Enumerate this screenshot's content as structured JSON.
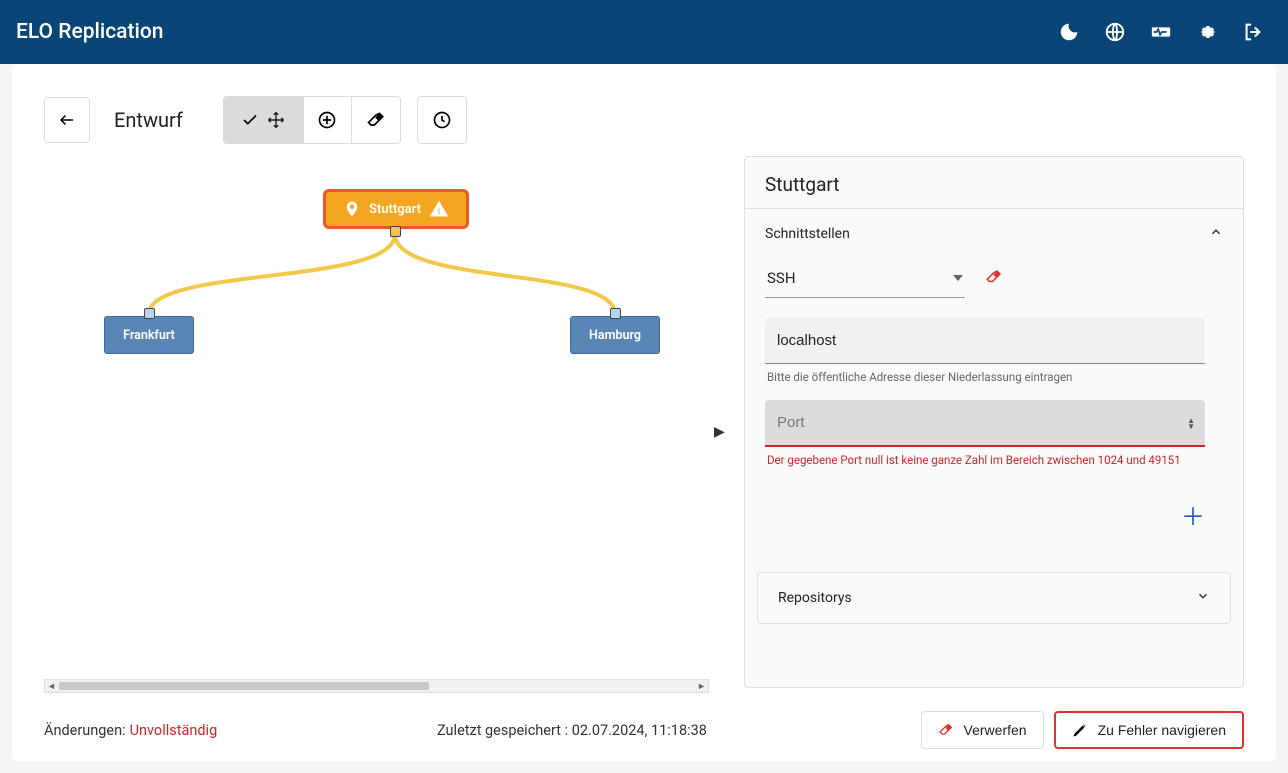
{
  "header": {
    "title": "ELO Replication"
  },
  "page": {
    "draft_label": "Entwurf"
  },
  "canvas": {
    "root_node": "Stuttgart",
    "child_left": "Frankfurt",
    "child_right": "Hamburg"
  },
  "panel": {
    "title": "Stuttgart",
    "section_interfaces": "Schnittstellen",
    "section_repos": "Repositorys",
    "protocol": "SSH",
    "host_value": "localhost",
    "host_hint": "Bitte die öffentliche Adresse dieser Niederlassung eintragen",
    "port_placeholder": "Port",
    "port_error": "Der gegebene Port null ist keine ganze Zahl im Bereich zwischen 1024 und 49151"
  },
  "footer": {
    "changes_label": "Änderungen:",
    "status": "Unvollständig",
    "saved": "Zuletzt gespeichert : 02.07.2024, 11:18:38",
    "discard": "Verwerfen",
    "navigate": "Zu Fehler navigieren"
  }
}
